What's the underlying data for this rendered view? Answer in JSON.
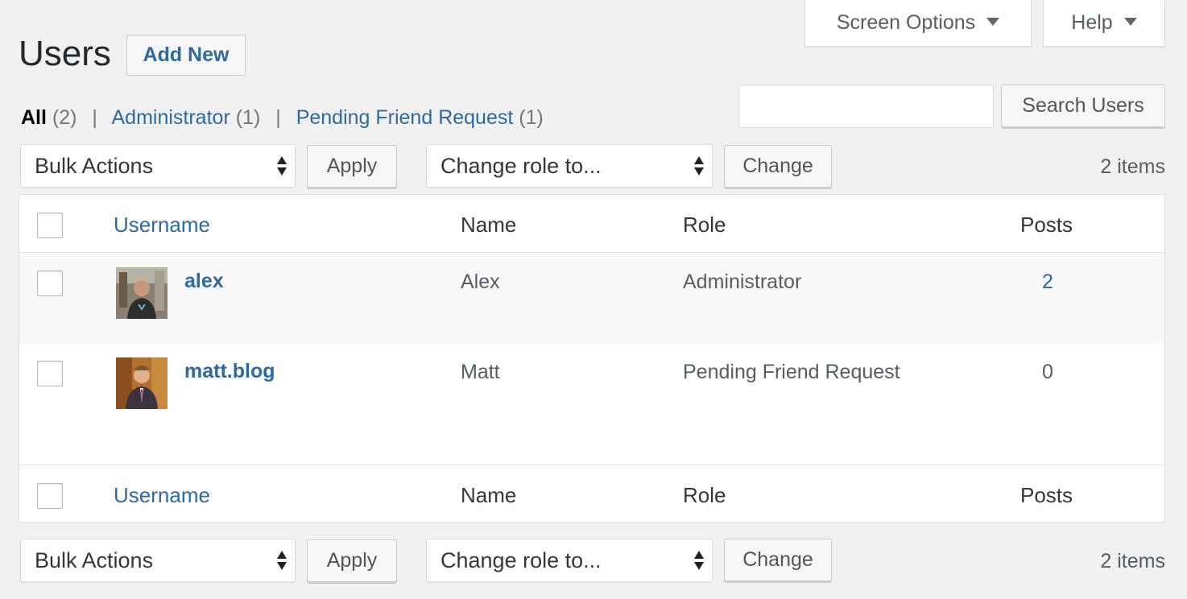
{
  "header": {
    "title": "Users",
    "add_new_label": "Add New",
    "screen_options_label": "Screen Options",
    "help_label": "Help"
  },
  "filters": {
    "all": {
      "label": "All",
      "count": "(2)"
    },
    "administrator": {
      "label": "Administrator",
      "count": "(1)"
    },
    "pending": {
      "label": "Pending Friend Request",
      "count": "(1)"
    },
    "separator": "|"
  },
  "search": {
    "value": "",
    "button_label": "Search Users"
  },
  "top_nav": {
    "bulk_actions": "Bulk Actions",
    "apply_label": "Apply",
    "change_role": "Change role to...",
    "change_label": "Change",
    "items_count": "2 items"
  },
  "bottom_nav": {
    "bulk_actions": "Bulk Actions",
    "apply_label": "Apply",
    "change_role": "Change role to...",
    "change_label": "Change",
    "items_count": "2 items"
  },
  "table": {
    "columns": [
      "Username",
      "Name",
      "Role",
      "Posts"
    ],
    "rows": [
      {
        "username": "alex",
        "name": "Alex",
        "role": "Administrator",
        "posts": "2",
        "avatar": "avatar-photo-alex"
      },
      {
        "username": "matt.blog",
        "name": "Matt",
        "role": "Pending Friend Request",
        "posts": "0",
        "avatar": "avatar-photo-matt"
      }
    ]
  },
  "colors": {
    "link": "#2c6aa1",
    "background": "#f1f1f1",
    "text": "#23282d"
  }
}
